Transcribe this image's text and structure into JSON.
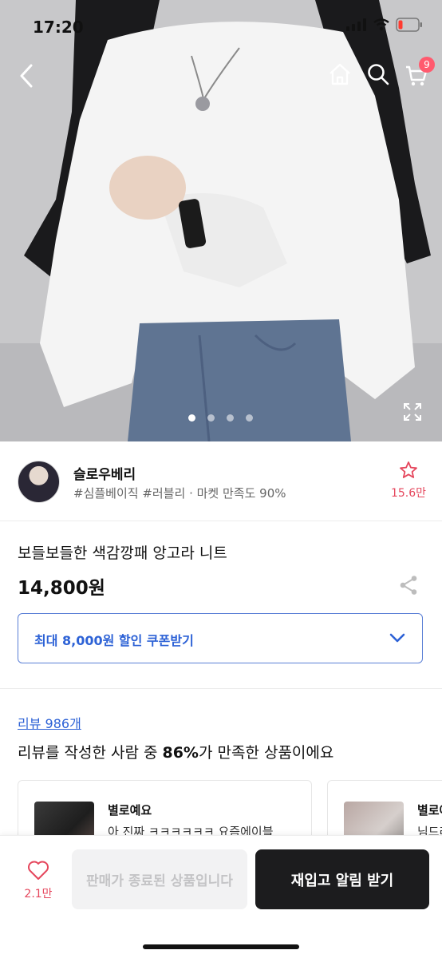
{
  "status_bar": {
    "time": "17:20"
  },
  "header": {
    "cart_count": "9"
  },
  "carousel": {
    "total": 4,
    "active_index": 0
  },
  "shop": {
    "name": "슬로우베리",
    "tags": "#심플베이직 #러블리 · 마켓 만족도 90%",
    "favorite_count": "15.6만"
  },
  "product": {
    "name": "보들보들한 색감깡패 앙고라 니트",
    "price": "14,800원",
    "coupon_label": "최대 8,000원 할인 쿠폰받기"
  },
  "reviews": {
    "link_label": "리뷰 986개",
    "summary_prefix": "리뷰를 작성한 사람 중 ",
    "summary_percent": "86%",
    "summary_suffix": "가 만족한 상품이에요",
    "cards": [
      {
        "title": "별로예요",
        "body": "아 진짜 ㅋㅋㅋㅋㅋㅋ 요즘에이블"
      },
      {
        "title": "별로예",
        "body": "님드라"
      }
    ]
  },
  "bottom_bar": {
    "like_count": "2.1만",
    "sold_out_label": "판매가 종료된 상품입니다",
    "restock_label": "재입고 알림 받기"
  },
  "colors": {
    "accent_blue": "#2d62d6",
    "accent_red": "#e5465c",
    "badge": "#ff5a6e",
    "dark_button": "#1c1c1e"
  }
}
